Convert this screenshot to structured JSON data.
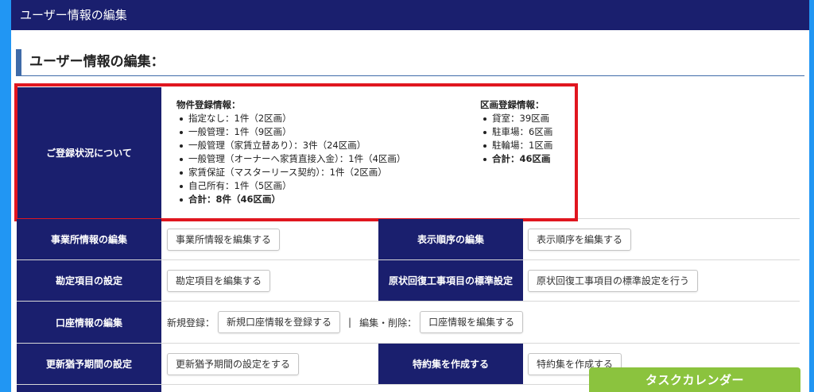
{
  "header": {
    "title": "ユーザー情報の編集"
  },
  "section_title": "ユーザー情報の編集：",
  "status": {
    "label": "ご登録状況について",
    "property": {
      "title": "物件登録情報：",
      "items": [
        "指定なし：1件（2区画）",
        "一般管理：1件（9区画）",
        "一般管理（家賃立替あり）：3件（24区画）",
        "一般管理（オーナーへ家賃直接入金）：1件（4区画）",
        "家賃保証（マスターリース契約）：1件（2区画）",
        "自己所有：1件（5区画）"
      ],
      "total": "合計：8件（46区画）"
    },
    "units": {
      "title": "区画登録情報：",
      "items": [
        "貸室：39区画",
        "駐車場：6区画",
        "駐輪場：1区画"
      ],
      "total": "合計：46区画"
    }
  },
  "rows": {
    "office": {
      "label": "事業所情報の編集",
      "button": "事業所情報を編集する"
    },
    "order": {
      "label": "表示順序の編集",
      "button": "表示順序を編集する"
    },
    "account_item": {
      "label": "勘定項目の設定",
      "button": "勘定項目を編集する"
    },
    "restoration": {
      "label": "原状回復工事項目の標準設定",
      "button": "原状回復工事項目の標準設定を行う"
    },
    "bank": {
      "label": "口座情報の編集",
      "new_label": "新規登録：",
      "new_button": "新規口座情報を登録する",
      "separator": "|",
      "edit_label": "編集・削除：",
      "edit_button": "口座情報を編集する"
    },
    "grace": {
      "label": "更新猶予期間の設定",
      "button": "更新猶予期間の設定をする"
    },
    "special": {
      "label": "特約集を作成する",
      "button": "特約集を作成する"
    }
  },
  "task_calendar": "タスクカレンダー"
}
